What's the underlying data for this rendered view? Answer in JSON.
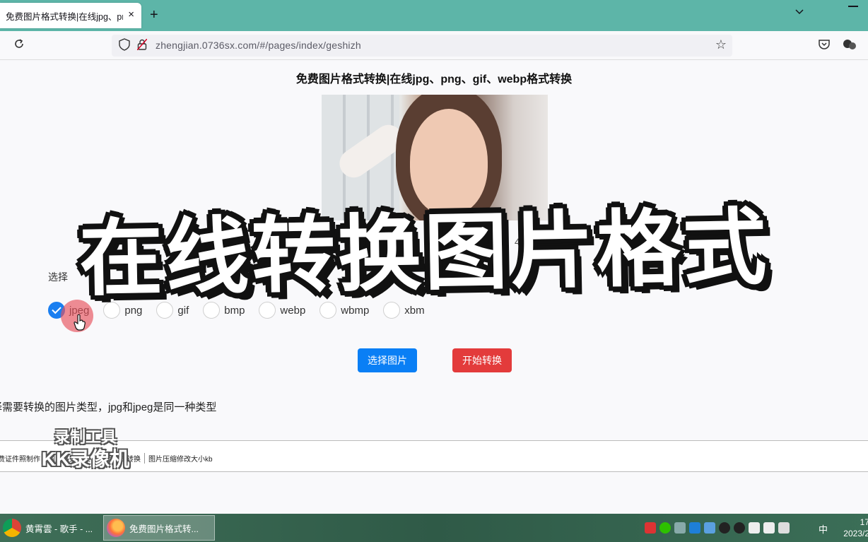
{
  "browser": {
    "tab_title": "免费图片格式转换|在线jpg、pr",
    "tab_close": "×",
    "new_tab": "+",
    "url": "zhengjian.0736sx.com/#/pages/index/geshizh"
  },
  "page": {
    "title": "免费图片格式转换|在线jpg、png、gif、webp格式转换",
    "size_info": "422",
    "choose_label": "选择",
    "formats": [
      {
        "label": "jpeg",
        "checked": true
      },
      {
        "label": "png",
        "checked": false
      },
      {
        "label": "gif",
        "checked": false
      },
      {
        "label": "bmp",
        "checked": false
      },
      {
        "label": "webp",
        "checked": false
      },
      {
        "label": "wbmp",
        "checked": false
      },
      {
        "label": "xbm",
        "checked": false
      }
    ],
    "select_button": "选择图片",
    "convert_button": "开始转换",
    "hint": "择需要转换的图片类型，jpg和jpeg是同一种类型",
    "footer_links": [
      "费证件照制作",
      "图片格式转换",
      "图片格式转换",
      "图片压缩修改大小kb"
    ]
  },
  "overlay": {
    "caption": "在线转换图片格式",
    "watermark_line1": "录制工具",
    "watermark_line2": "KK录像机"
  },
  "taskbar": {
    "task1": "黄霄雲 - 歌手 - ...",
    "task2": "免费图片格式转...",
    "ime": "中",
    "clock_line1": "17",
    "clock_line2": "2023/2"
  },
  "colors": {
    "tabstrip": "#5db5a8",
    "primary": "#0a7ff5",
    "danger": "#e33b3b",
    "radio_checked": "#1a7ff0"
  }
}
